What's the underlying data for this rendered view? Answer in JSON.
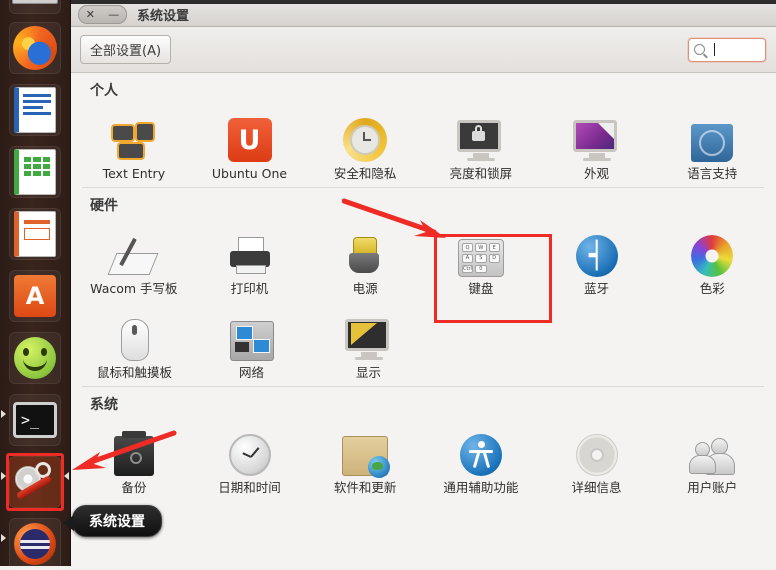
{
  "window": {
    "title": "系统设置",
    "close_label": "✕",
    "minimize_label": "—",
    "all_settings_label": "全部设置(A)",
    "search_placeholder": "",
    "search_value": ""
  },
  "sections": [
    {
      "name": "个人",
      "rows": [
        [
          {
            "label": "Text Entry",
            "icon": "text-entry-icon"
          },
          {
            "label": "Ubuntu One",
            "icon": "ubuntu-one-icon"
          },
          {
            "label": "安全和隐私",
            "icon": "security-privacy-icon"
          },
          {
            "label": "亮度和锁屏",
            "icon": "brightness-lock-icon"
          },
          {
            "label": "外观",
            "icon": "appearance-icon"
          },
          {
            "label": "语言支持",
            "icon": "language-support-icon"
          }
        ]
      ]
    },
    {
      "name": "硬件",
      "rows": [
        [
          {
            "label": "Wacom 手写板",
            "icon": "wacom-tablet-icon"
          },
          {
            "label": "打印机",
            "icon": "printer-icon"
          },
          {
            "label": "电源",
            "icon": "power-icon"
          },
          {
            "label": "键盘",
            "icon": "keyboard-icon"
          },
          {
            "label": "蓝牙",
            "icon": "bluetooth-icon"
          },
          {
            "label": "色彩",
            "icon": "color-icon"
          }
        ],
        [
          {
            "label": "鼠标和触摸板",
            "icon": "mouse-touchpad-icon"
          },
          {
            "label": "网络",
            "icon": "network-icon"
          },
          {
            "label": "显示",
            "icon": "display-icon"
          }
        ]
      ]
    },
    {
      "name": "系统",
      "rows": [
        [
          {
            "label": "备份",
            "icon": "backup-icon"
          },
          {
            "label": "日期和时间",
            "icon": "date-time-icon"
          },
          {
            "label": "软件和更新",
            "icon": "software-updates-icon"
          },
          {
            "label": "通用辅助功能",
            "icon": "universal-access-icon"
          },
          {
            "label": "详细信息",
            "icon": "details-icon"
          },
          {
            "label": "用户账户",
            "icon": "user-accounts-icon"
          }
        ]
      ]
    }
  ],
  "keyboard_keys": [
    "Q",
    "W",
    "E",
    "A",
    "S",
    "D",
    "Ctrl",
    "0"
  ],
  "launcher": {
    "items": [
      {
        "icon": "window-thumbnail-icon"
      },
      {
        "icon": "firefox-icon"
      },
      {
        "icon": "libreoffice-writer-icon"
      },
      {
        "icon": "libreoffice-calc-icon"
      },
      {
        "icon": "libreoffice-impress-icon"
      },
      {
        "icon": "amazon-icon"
      },
      {
        "icon": "ubuntu-software-center-icon"
      },
      {
        "icon": "terminal-icon"
      },
      {
        "icon": "system-settings-icon"
      },
      {
        "icon": "ubuntu-one-launcher-icon"
      }
    ],
    "terminal_prompt": ">_",
    "amazon_letter": "a"
  },
  "tooltip": {
    "text": "系统设置"
  },
  "annotations": {
    "highlight_color": "#ee2b24",
    "highlighted_items": [
      "键盘",
      "system-settings-icon"
    ]
  }
}
